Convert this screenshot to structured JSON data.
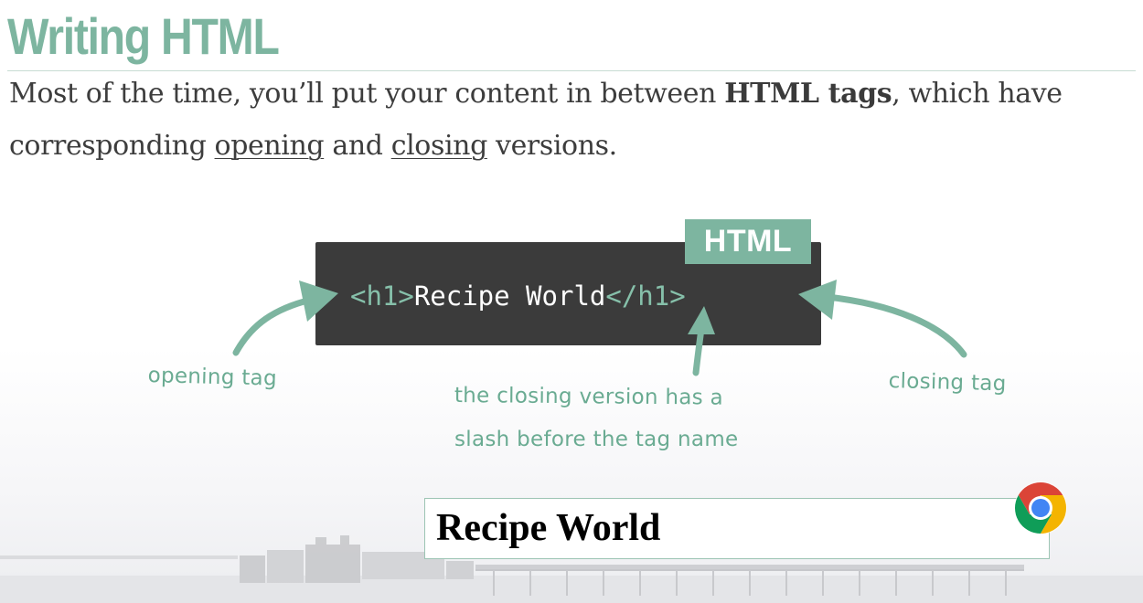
{
  "slide": {
    "title": "Writing HTML",
    "paragraph": {
      "part1": "Most of the time, you’ll put your content in between ",
      "bold": "HTML tags",
      "part2": ", which have corresponding ",
      "opening": "opening",
      "part3": " and ",
      "closing": "closing",
      "part4": " versions."
    }
  },
  "code_example": {
    "badge": "HTML",
    "open_tag": "<h1>",
    "content": "Recipe World",
    "close_tag": "</h1>"
  },
  "annotations": {
    "opening": "opening tag",
    "closing": "closing tag",
    "slash_line1": "the closing version has a",
    "slash_line2": "slash before the tag name"
  },
  "browser_preview": {
    "heading": "Recipe World",
    "browser_icon": "chrome-icon"
  },
  "colors": {
    "accent": "#7db5a0",
    "code_bg": "#3b3b3b",
    "annotation": "#6aab92",
    "text": "#3d3d3d"
  }
}
